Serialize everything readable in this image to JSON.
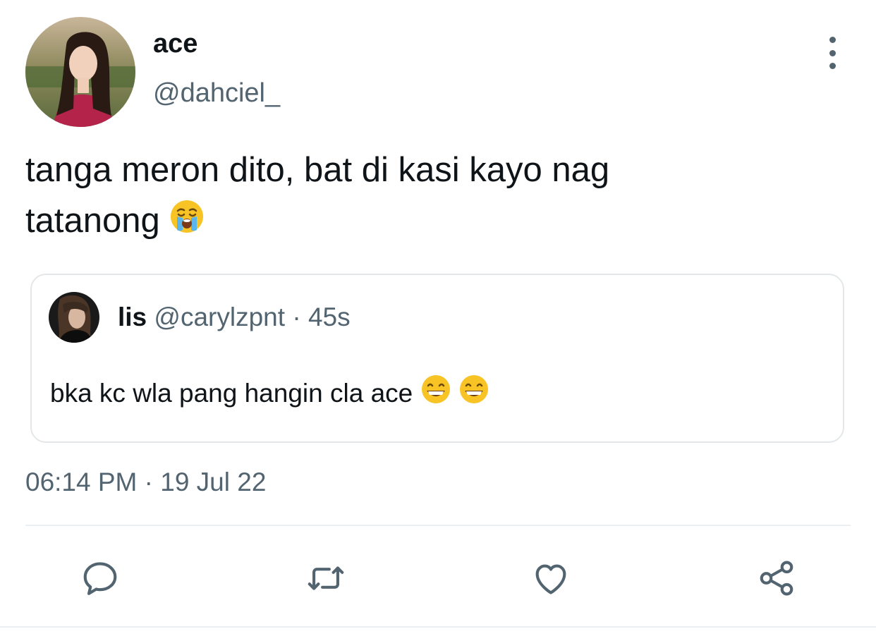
{
  "tweet": {
    "author": {
      "display_name": "ace",
      "handle": "@dahciel_"
    },
    "text_line1": "tanga meron dito, bat di kasi kayo nag",
    "text_line2": "tatanong",
    "text_emoji": "loudly-crying-face",
    "timestamp": "06:14 PM · 19 Jul 22"
  },
  "quote": {
    "display_name": "lis",
    "handle": "@carylzpnt",
    "separator": "·",
    "time": "45s",
    "text": "bka kc wla pang hangin cla ace",
    "emojis": [
      "grinning-face-with-smiling-eyes",
      "grinning-face-with-smiling-eyes"
    ]
  },
  "actions": {
    "icons": [
      "reply-icon",
      "retweet-icon",
      "like-icon",
      "share-icon"
    ]
  },
  "colors": {
    "text_primary": "#0f1419",
    "text_secondary": "#536471",
    "border": "#e3e7ea",
    "divider": "#eceff1",
    "emoji_yellow": "#f7c325"
  }
}
